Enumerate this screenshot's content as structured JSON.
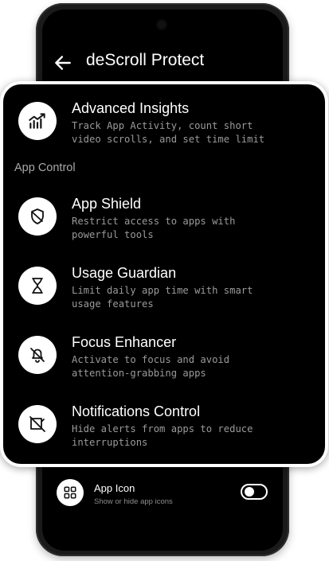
{
  "header": {
    "title": "deScroll Protect",
    "back_icon": "arrow-left-icon"
  },
  "card": {
    "featured": {
      "title": "Advanced Insights",
      "description": "Track App Activity, count short video scrolls, and set time limit",
      "icon": "trending-chart-icon"
    },
    "section_label": "App Control",
    "items": [
      {
        "title": "App Shield",
        "description": "Restrict access to apps with powerful tools",
        "icon": "shield-off-icon"
      },
      {
        "title": "Usage Guardian",
        "description": "Limit daily app time with smart usage features",
        "icon": "hourglass-icon"
      },
      {
        "title": "Focus Enhancer",
        "description": "Activate to focus and avoid attention-grabbing apps",
        "icon": "bell-off-icon"
      },
      {
        "title": "Notifications Control",
        "description": "Hide alerts from apps to reduce interruptions",
        "icon": "notification-off-icon"
      }
    ]
  },
  "app_icon_setting": {
    "title": "App Icon",
    "subtitle": "Show or hide app icons",
    "icon": "grid-icon",
    "enabled": false
  },
  "colors": {
    "background": "#000000",
    "text": "#ffffff",
    "secondary_text": "#9a9a9a",
    "icon_circle": "#ffffff"
  }
}
